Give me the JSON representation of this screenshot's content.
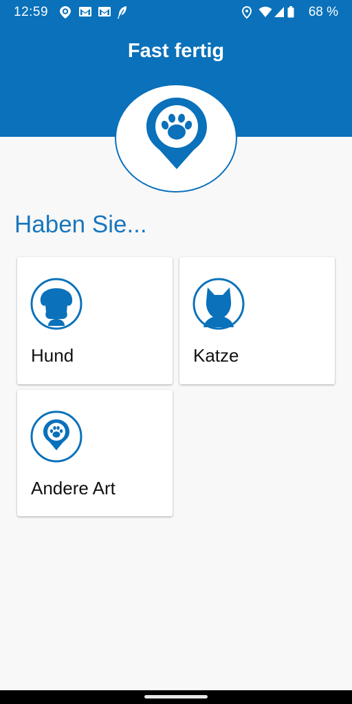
{
  "status_bar": {
    "time": "12:59",
    "battery": "68 %",
    "icons": [
      "pokemon-go-icon",
      "gmail-icon",
      "gmail-icon",
      "feather-icon",
      "location-icon",
      "wifi-icon",
      "signal-icon",
      "battery-icon"
    ]
  },
  "header": {
    "title": "Fast fertig",
    "logo_icon": "paw-pin-icon"
  },
  "main": {
    "heading": "Haben Sie...",
    "options": [
      {
        "label": "Hund",
        "icon": "dog-icon"
      },
      {
        "label": "Katze",
        "icon": "cat-icon"
      },
      {
        "label": "Andere Art",
        "icon": "paw-pin-icon"
      }
    ]
  },
  "colors": {
    "brand": "#0a71ba",
    "heading": "#1a76bd",
    "background": "#f8f8f8",
    "card": "#ffffff"
  }
}
